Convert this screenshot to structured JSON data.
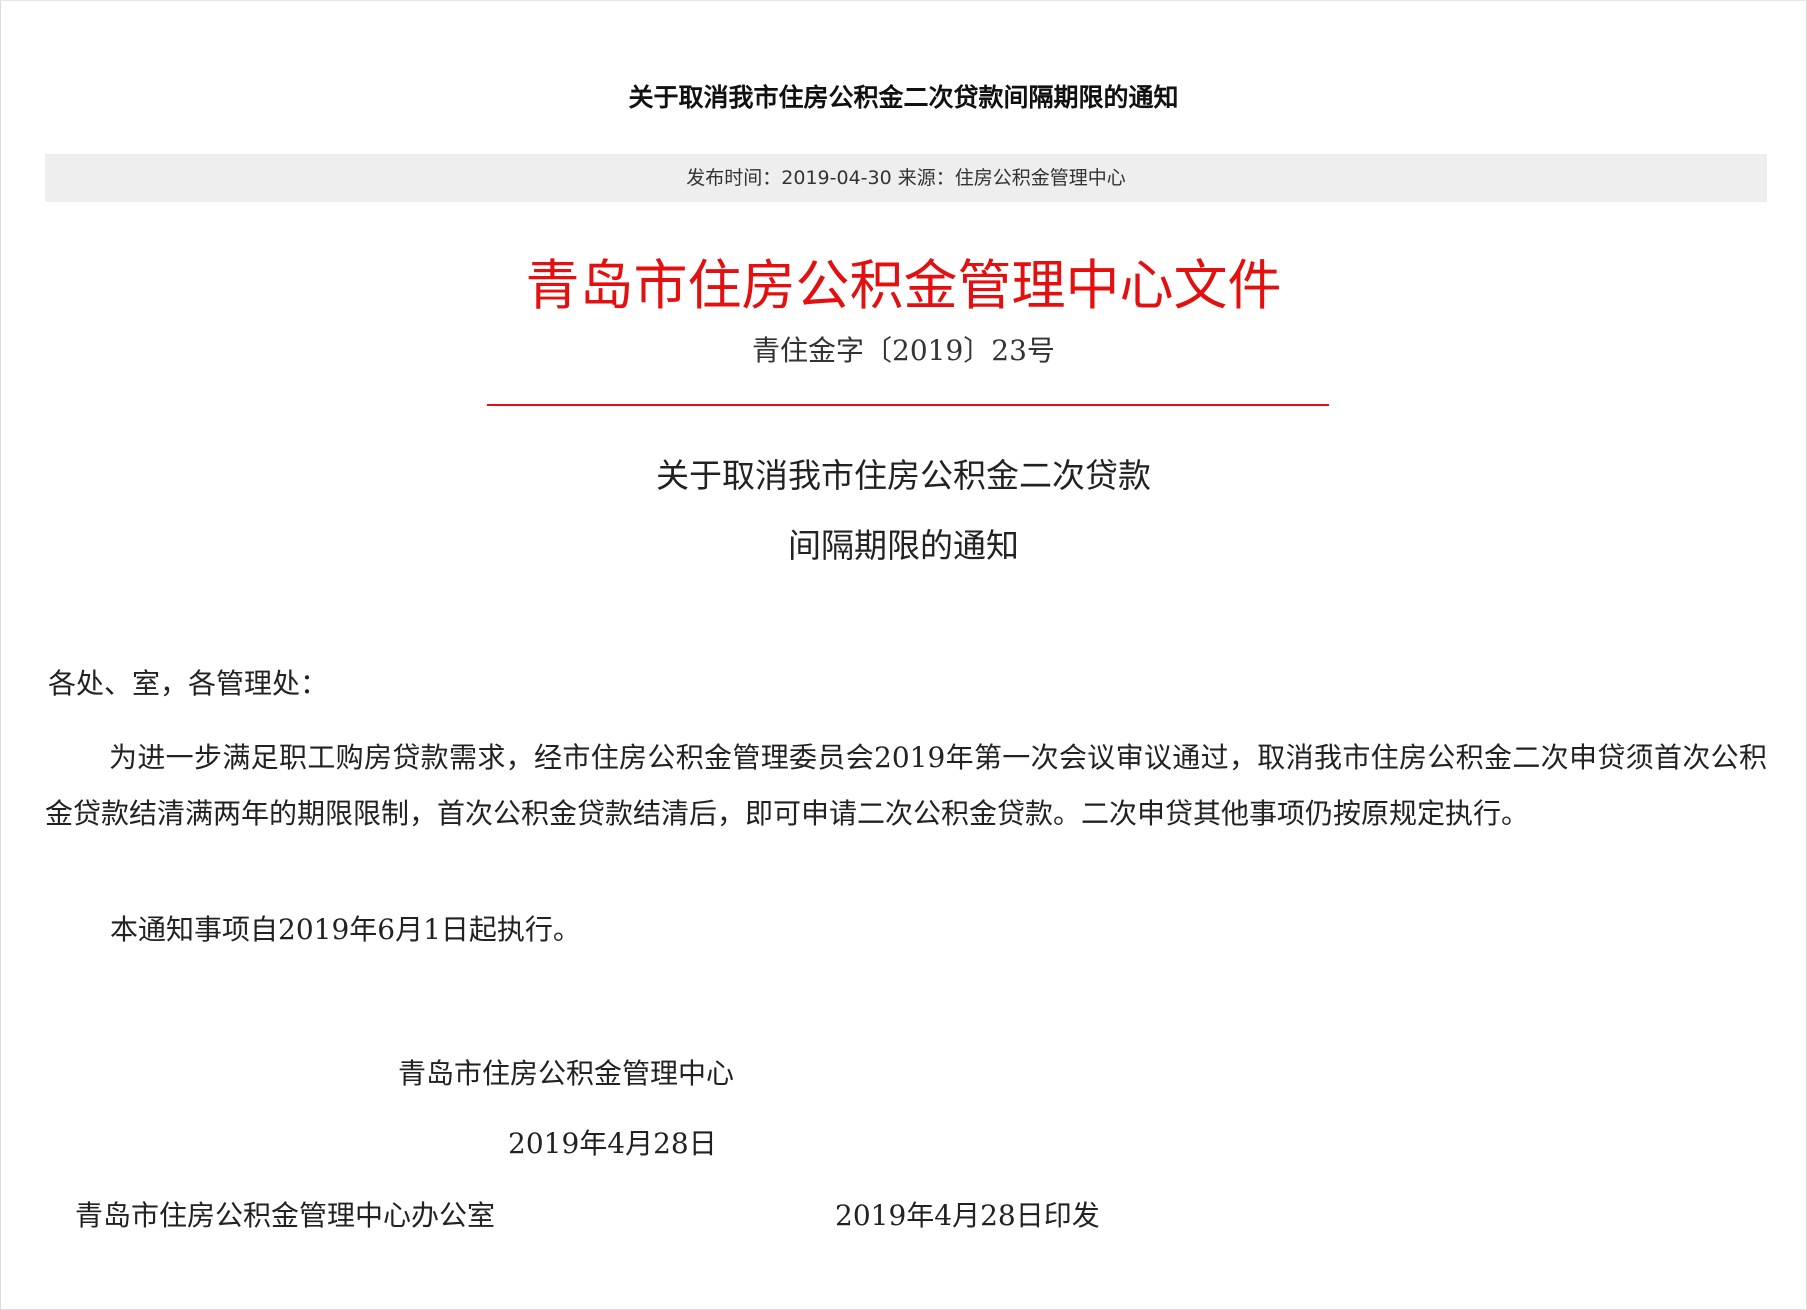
{
  "page": {
    "title": "关于取消我市住房公积金二次贷款间隔期限的通知",
    "meta": "发布时间：2019-04-30 来源：住房公积金管理中心"
  },
  "document": {
    "header": "青岛市住房公积金管理中心文件",
    "number": "青住金字〔2019〕23号",
    "title_line1": "关于取消我市住房公积金二次贷款",
    "title_line2": "间隔期限的通知",
    "salutation": "各处、室，各管理处：",
    "paragraph1": "为进一步满足职工购房贷款需求，经市住房公积金管理委员会2019年第一次会议审议通过，取消我市住房公积金二次申贷须首次公积金贷款结清满两年的期限限制，首次公积金贷款结清后，即可申请二次公积金贷款。二次申贷其他事项仍按原规定执行。",
    "paragraph2": "本通知事项自2019年6月1日起执行。",
    "signature_org": "青岛市住房公积金管理中心",
    "signature_date": "2019年4月28日",
    "footer_org": "青岛市住房公积金管理中心办公室",
    "footer_date": "2019年4月28日印发"
  },
  "colors": {
    "header_red": "#e41010",
    "meta_bar_bg": "#eeeeee"
  }
}
